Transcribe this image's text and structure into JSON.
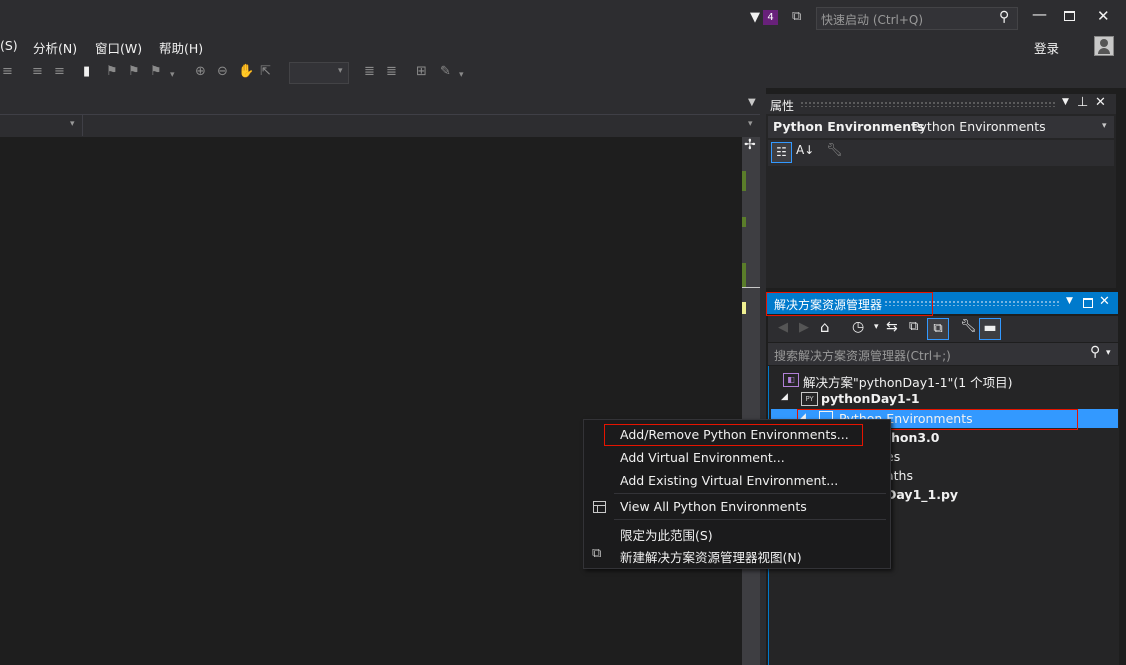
{
  "titlebar": {
    "notification_count": "4",
    "quick_launch_placeholder": "快速启动 (Ctrl+Q)",
    "sign_in": "登录"
  },
  "menu": {
    "items": [
      {
        "label": "(S)"
      },
      {
        "label": "分析(N)"
      },
      {
        "label": "窗口(W)"
      },
      {
        "label": "帮助(H)"
      }
    ]
  },
  "properties": {
    "title": "属性",
    "selected_name": "Python Environments",
    "selected_type": "Python Environments"
  },
  "solution_explorer": {
    "title": "解决方案资源管理器",
    "search_placeholder": "搜索解决方案资源管理器(Ctrl+;)",
    "tree": {
      "solution": "解决方案\"pythonDay1-1\"(1 个项目)",
      "project": "pythonDay1-1",
      "environments": "Python Environments",
      "env_item": "thon3.0",
      "refs": "es",
      "paths": "aths",
      "file": "Day1_1.py"
    }
  },
  "context_menu": {
    "items": [
      {
        "label": "Add/Remove Python Environments..."
      },
      {
        "label": "Add Virtual Environment..."
      },
      {
        "label": "Add Existing Virtual Environment..."
      },
      {
        "label": "View All Python Environments"
      },
      {
        "label": "限定为此范围(S)"
      },
      {
        "label": "新建解决方案资源管理器视图(N)"
      }
    ]
  },
  "colors": {
    "accent": "#007acc",
    "highlight_box": "#e51400",
    "background": "#1e1e1e",
    "chrome": "#2d2d30"
  }
}
